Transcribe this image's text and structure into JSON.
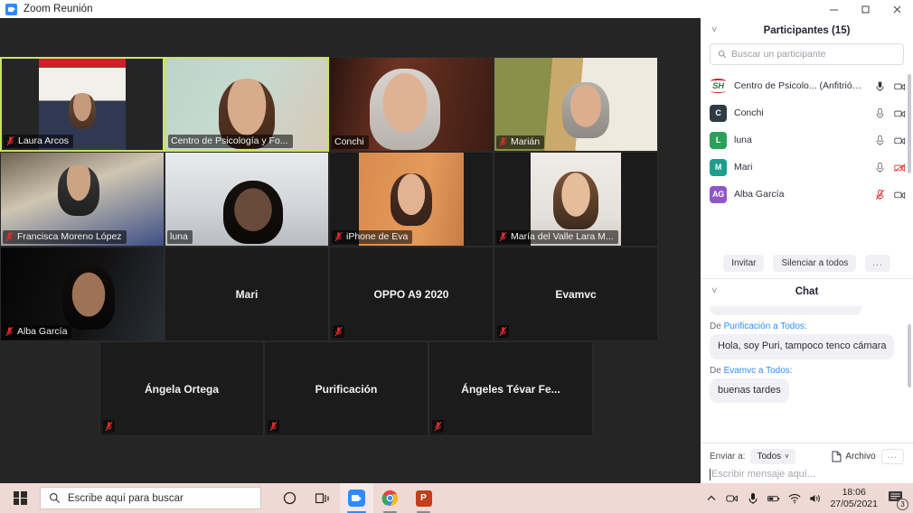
{
  "window": {
    "title": "Zoom Reunión",
    "app_icon": "zoom-icon",
    "minimize": "minimize-icon",
    "maximize": "maximize-icon",
    "close": "close-icon"
  },
  "gallery": {
    "rows": [
      {
        "tiles": [
          {
            "name": "Laura Arcos",
            "video": true,
            "muted": true,
            "active": false,
            "style": "v-laura"
          },
          {
            "name": "Centro de Psicología y Fo...",
            "video": true,
            "muted": false,
            "active": true,
            "style": "v-centro"
          },
          {
            "name": "Conchi",
            "video": true,
            "muted": false,
            "active": false,
            "style": "v-conchi"
          },
          {
            "name": "Marián",
            "video": true,
            "muted": true,
            "active": false,
            "style": "v-marian"
          }
        ]
      },
      {
        "tiles": [
          {
            "name": "Francisca Moreno López",
            "video": true,
            "muted": true,
            "active": false,
            "style": "v-francisca"
          },
          {
            "name": "luna",
            "video": true,
            "muted": false,
            "active": false,
            "style": "v-luna"
          },
          {
            "name": "iPhone de Eva",
            "video": true,
            "muted": true,
            "active": false,
            "style": "v-eva"
          },
          {
            "name": "María del Valle Lara M...",
            "video": true,
            "muted": true,
            "active": false,
            "style": "v-valle"
          }
        ]
      },
      {
        "tiles": [
          {
            "name": "Alba García",
            "video": true,
            "muted": true,
            "active": false,
            "style": "v-alba"
          },
          {
            "name": "Mari",
            "video": false,
            "muted": false,
            "active": false,
            "style": ""
          },
          {
            "name": "OPPO A9 2020",
            "video": false,
            "muted": true,
            "active": false,
            "style": ""
          },
          {
            "name": "Evamvc",
            "video": false,
            "muted": true,
            "active": false,
            "style": ""
          }
        ]
      },
      {
        "tiles": [
          {
            "name": "Ángela Ortega",
            "video": false,
            "muted": true,
            "active": false,
            "style": ""
          },
          {
            "name": "Purificación",
            "video": false,
            "muted": true,
            "active": false,
            "style": ""
          },
          {
            "name": "Ángeles Tévar Fe...",
            "video": false,
            "muted": true,
            "active": false,
            "style": ""
          }
        ]
      }
    ]
  },
  "participants": {
    "title": "Participantes (15)",
    "collapse_icon": "chevron-down-icon",
    "search_placeholder": "Buscar un participante",
    "search_value": "",
    "search_icon": "search-icon",
    "list": [
      {
        "initials": "SH",
        "name": "Centro de Psicolo... (Anfitrión, yo)",
        "avatar_color": "#ffffff",
        "mic": "on",
        "cam": "on"
      },
      {
        "initials": "C",
        "name": "Conchi",
        "avatar_color": "#2d3b45",
        "mic": "on",
        "cam": "on"
      },
      {
        "initials": "L",
        "name": "luna",
        "avatar_color": "#2aa05a",
        "mic": "on",
        "cam": "on"
      },
      {
        "initials": "M",
        "name": "Mari",
        "avatar_color": "#17a08c",
        "mic": "on",
        "cam": "off"
      },
      {
        "initials": "AG",
        "name": "Alba García",
        "avatar_color": "#9255c9",
        "mic": "off",
        "cam": "on"
      }
    ],
    "actions": {
      "invite": "Invitar",
      "mute_all": "Silenciar a todos",
      "more": "..."
    }
  },
  "chat": {
    "title": "Chat",
    "collapse_icon": "chevron-down-icon",
    "messages": [
      {
        "from_prefix": "De",
        "from": "Purificación",
        "to": "a Todos:",
        "text": "Hola, soy Puri, tampoco tenco cámara"
      },
      {
        "from_prefix": "De",
        "from": "Evamvc",
        "to": "a Todos:",
        "text": "buenas tardes"
      }
    ],
    "send_to_label": "Enviar a:",
    "send_to_value": "Todos",
    "send_to_chevron": "chevron-down-icon",
    "file_label": "Archivo",
    "file_icon": "file-icon",
    "more": "...",
    "input_placeholder": "Escribir mensaje aquí...",
    "input_value": ""
  },
  "taskbar": {
    "start_icon": "windows-logo-icon",
    "search_placeholder": "Escribe aquí para buscar",
    "search_icon": "search-icon",
    "apps": [
      {
        "name": "cortana-icon"
      },
      {
        "name": "task-view-icon"
      },
      {
        "name": "zoom-icon"
      },
      {
        "name": "chrome-icon"
      },
      {
        "name": "powerpoint-icon"
      }
    ],
    "tray": [
      {
        "name": "show-hidden-icons-icon"
      },
      {
        "name": "camera-icon"
      },
      {
        "name": "microphone-icon"
      },
      {
        "name": "battery-icon"
      },
      {
        "name": "wifi-icon"
      },
      {
        "name": "volume-icon"
      }
    ],
    "time": "18:06",
    "date": "27/05/2021",
    "notification_icon": "notification-icon",
    "notification_count": "3"
  },
  "colors": {
    "accent": "#2d8cff",
    "active_speaker_border": "#c9e265",
    "mute_red": "#e02b2b",
    "taskbar_bg": "#efd9d5"
  }
}
